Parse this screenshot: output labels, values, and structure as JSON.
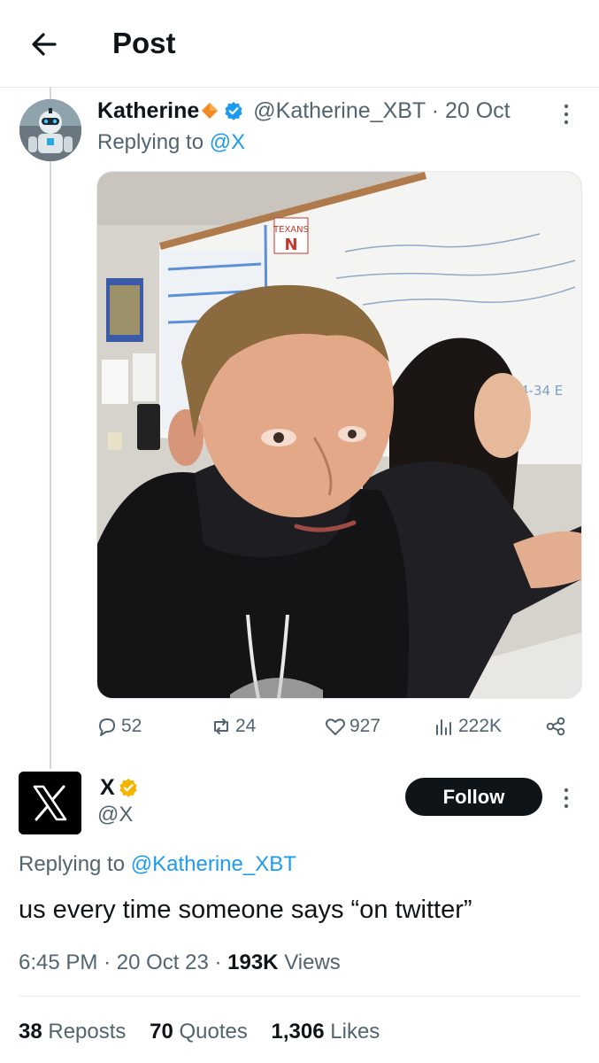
{
  "header": {
    "title": "Post",
    "back_icon": "arrow-left-icon"
  },
  "post1": {
    "display_name": "Katherine",
    "handle": "@Katherine_XBT",
    "separator": "·",
    "date": "20 Oct",
    "replying_prefix": "Replying to",
    "replying_to": "@X",
    "media_text": {
      "board_logo": "TEXANS",
      "board_note": "4-34 E"
    },
    "actions": {
      "replies": "52",
      "reposts": "24",
      "likes": "927",
      "views": "222K"
    }
  },
  "post2": {
    "display_name": "X",
    "handle": "@X",
    "follow_label": "Follow",
    "replying_prefix": "Replying to",
    "replying_to": "@Katherine_XBT",
    "text": "us every time someone says “on twitter”",
    "time": "6:45 PM",
    "sep1": "·",
    "date": "20 Oct 23",
    "sep2": "·",
    "views_count": "193K",
    "views_label": "Views",
    "reposts_count": "38",
    "reposts_label": "Reposts",
    "quotes_count": "70",
    "quotes_label": "Quotes",
    "likes_count": "1,306",
    "likes_label": "Likes"
  },
  "colors": {
    "accent": "#1d9bf0",
    "gold": "#f4b400",
    "text": "#0f1419",
    "muted": "#536471"
  }
}
